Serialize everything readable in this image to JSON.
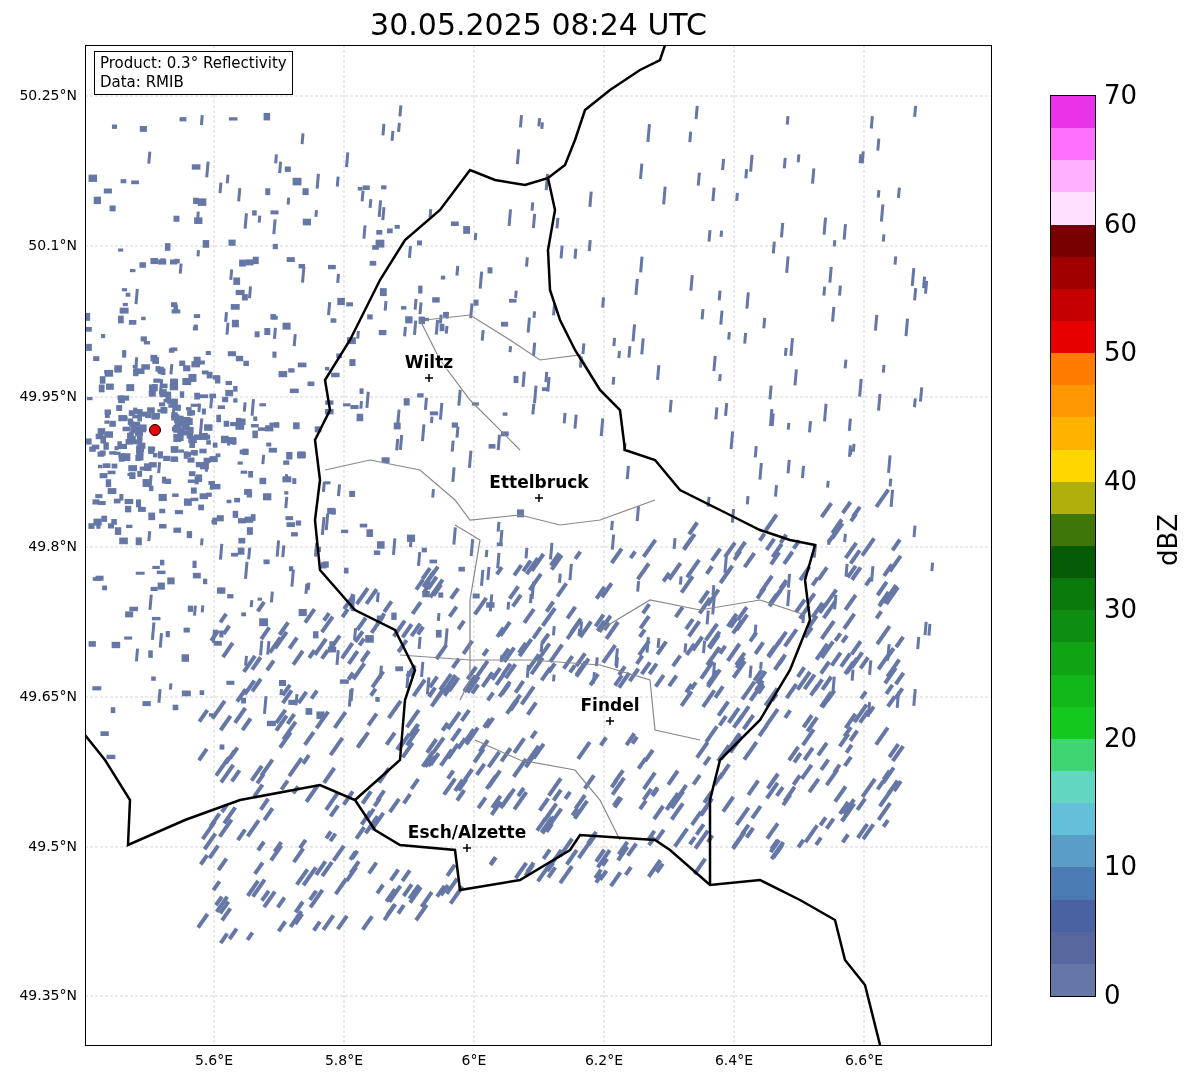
{
  "title": "30.05.2025 08:24 UTC",
  "info_box": [
    "Product: 0.3° Reflectivity",
    "Data: RMIB"
  ],
  "map": {
    "lat_ticks": [
      "50.25°N",
      "50.1°N",
      "49.95°N",
      "49.8°N",
      "49.65°N",
      "49.5°N",
      "49.35°N"
    ],
    "lon_ticks": [
      "5.6°E",
      "5.8°E",
      "6°E",
      "6.2°E",
      "6.4°E",
      "6.6°E"
    ],
    "cities": [
      {
        "name": "Wiltz"
      },
      {
        "name": "Ettelbruck"
      },
      {
        "name": "Findel"
      },
      {
        "name": "Esch/Alzette"
      }
    ]
  },
  "colorbar": {
    "label": "dBZ",
    "ticks": [
      "70",
      "60",
      "50",
      "40",
      "30",
      "20",
      "10",
      "0"
    ],
    "segments": [
      {
        "color": "#e833e8"
      },
      {
        "color": "#ff70ff"
      },
      {
        "color": "#ffb0ff"
      },
      {
        "color": "#ffe0ff"
      },
      {
        "color": "#780000"
      },
      {
        "color": "#a00000"
      },
      {
        "color": "#c40000"
      },
      {
        "color": "#e60000"
      },
      {
        "color": "#ff7c00"
      },
      {
        "color": "#ff9800"
      },
      {
        "color": "#ffb300"
      },
      {
        "color": "#ffd700"
      },
      {
        "color": "#b0b00a"
      },
      {
        "color": "#3f760a"
      },
      {
        "color": "#065c06"
      },
      {
        "color": "#0a7a0c"
      },
      {
        "color": "#0e8e10"
      },
      {
        "color": "#10a414"
      },
      {
        "color": "#12b81a"
      },
      {
        "color": "#14c81e"
      },
      {
        "color": "#3ed672"
      },
      {
        "color": "#62d6c0"
      },
      {
        "color": "#64bfd8"
      },
      {
        "color": "#5a9ec6"
      },
      {
        "color": "#4a7bb2"
      },
      {
        "color": "#4a62a2"
      },
      {
        "color": "#56689e"
      },
      {
        "color": "#6577a6"
      }
    ]
  }
}
